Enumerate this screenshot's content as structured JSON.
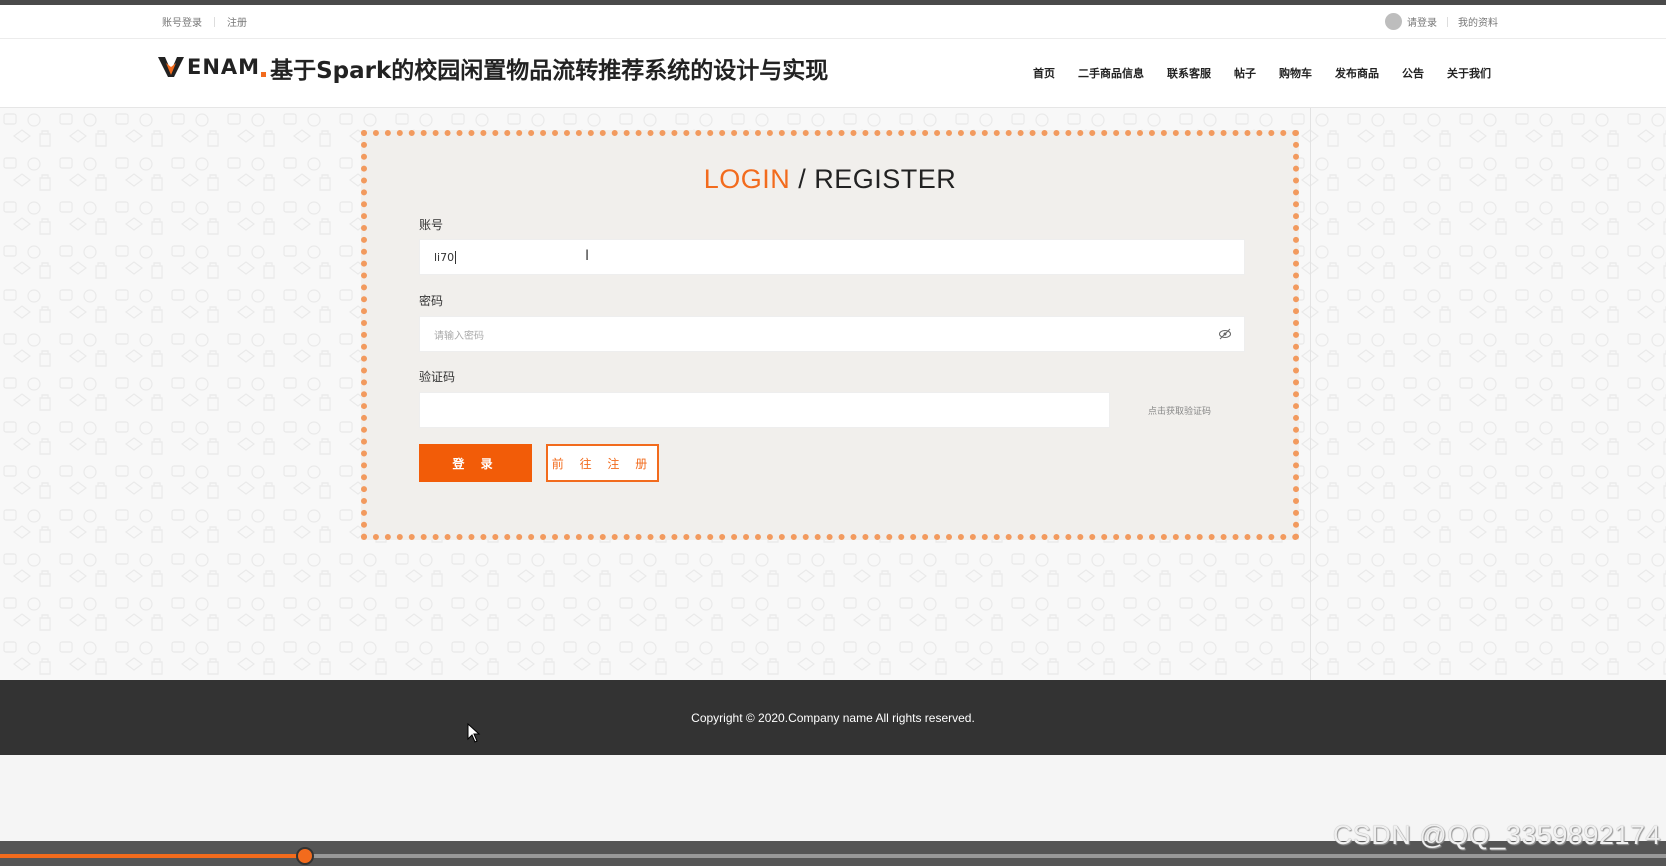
{
  "utility_bar": {
    "account_login": "账号登录",
    "register": "注册",
    "please_login": "请登录",
    "my_profile": "我的资料"
  },
  "header": {
    "brand": "ENAM",
    "site_title": "基于Spark的校园闲置物品流转推荐系统的设计与实现",
    "nav": [
      "首页",
      "二手商品信息",
      "联系客服",
      "帖子",
      "购物车",
      "发布商品",
      "公告",
      "关于我们"
    ]
  },
  "login_card": {
    "title_highlight": "LOGIN",
    "title_rest": " / REGISTER",
    "account_label": "账号",
    "account_value": "li70",
    "password_label": "密码",
    "password_placeholder": "请输入密码",
    "captcha_label": "验证码",
    "captcha_link": "点击获取验证码",
    "login_button": "登 录",
    "register_button": "前 往 注 册"
  },
  "footer": {
    "copyright": "Copyright © 2020.Company name All rights reserved."
  },
  "player": {
    "progress": 0.183
  },
  "watermark": "CSDN @QQ_3359892174",
  "icons": {
    "logo": "v-logo-icon",
    "avatar": "avatar-icon",
    "password_toggle": "eye-off-icon",
    "text_cursor": "ibeam-cursor-icon",
    "mouse_pointer": "pointer-cursor-icon"
  },
  "colors": {
    "accent": "#f26b1d",
    "primary_button": "#f25c08",
    "footer": "#333333"
  }
}
